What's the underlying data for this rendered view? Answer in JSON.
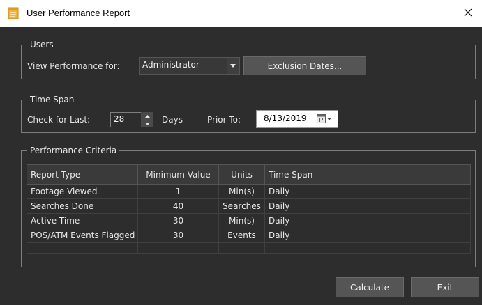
{
  "window": {
    "title": "User Performance Report",
    "app_icon": "notepad-icon",
    "close_icon": "close-icon"
  },
  "users_group": {
    "legend": "Users",
    "view_label": "View Performance for:",
    "user_selected": "Administrator",
    "exclusion_button": "Exclusion Dates..."
  },
  "time_span_group": {
    "legend": "Time Span",
    "check_label": "Check for Last:",
    "check_value": "28",
    "days_label": "Days",
    "prior_label": "Prior To:",
    "prior_date": "8/13/2019"
  },
  "criteria_group": {
    "legend": "Performance Criteria",
    "columns": [
      "Report Type",
      "Minimum Value",
      "Units",
      "Time Span"
    ],
    "rows": [
      [
        "Footage Viewed",
        "1",
        "Min(s)",
        "Daily"
      ],
      [
        "Searches Done",
        "40",
        "Searches",
        "Daily"
      ],
      [
        "Active Time",
        "30",
        "Min(s)",
        "Daily"
      ],
      [
        "POS/ATM Events Flagged",
        "30",
        "Events",
        "Daily"
      ]
    ]
  },
  "footer": {
    "calculate_button": "Calculate",
    "exit_button": "Exit"
  },
  "colors": {
    "background": "#2d2d2d",
    "titlebar": "#ffffff",
    "button": "#555555",
    "text": "#e6e6e6"
  }
}
